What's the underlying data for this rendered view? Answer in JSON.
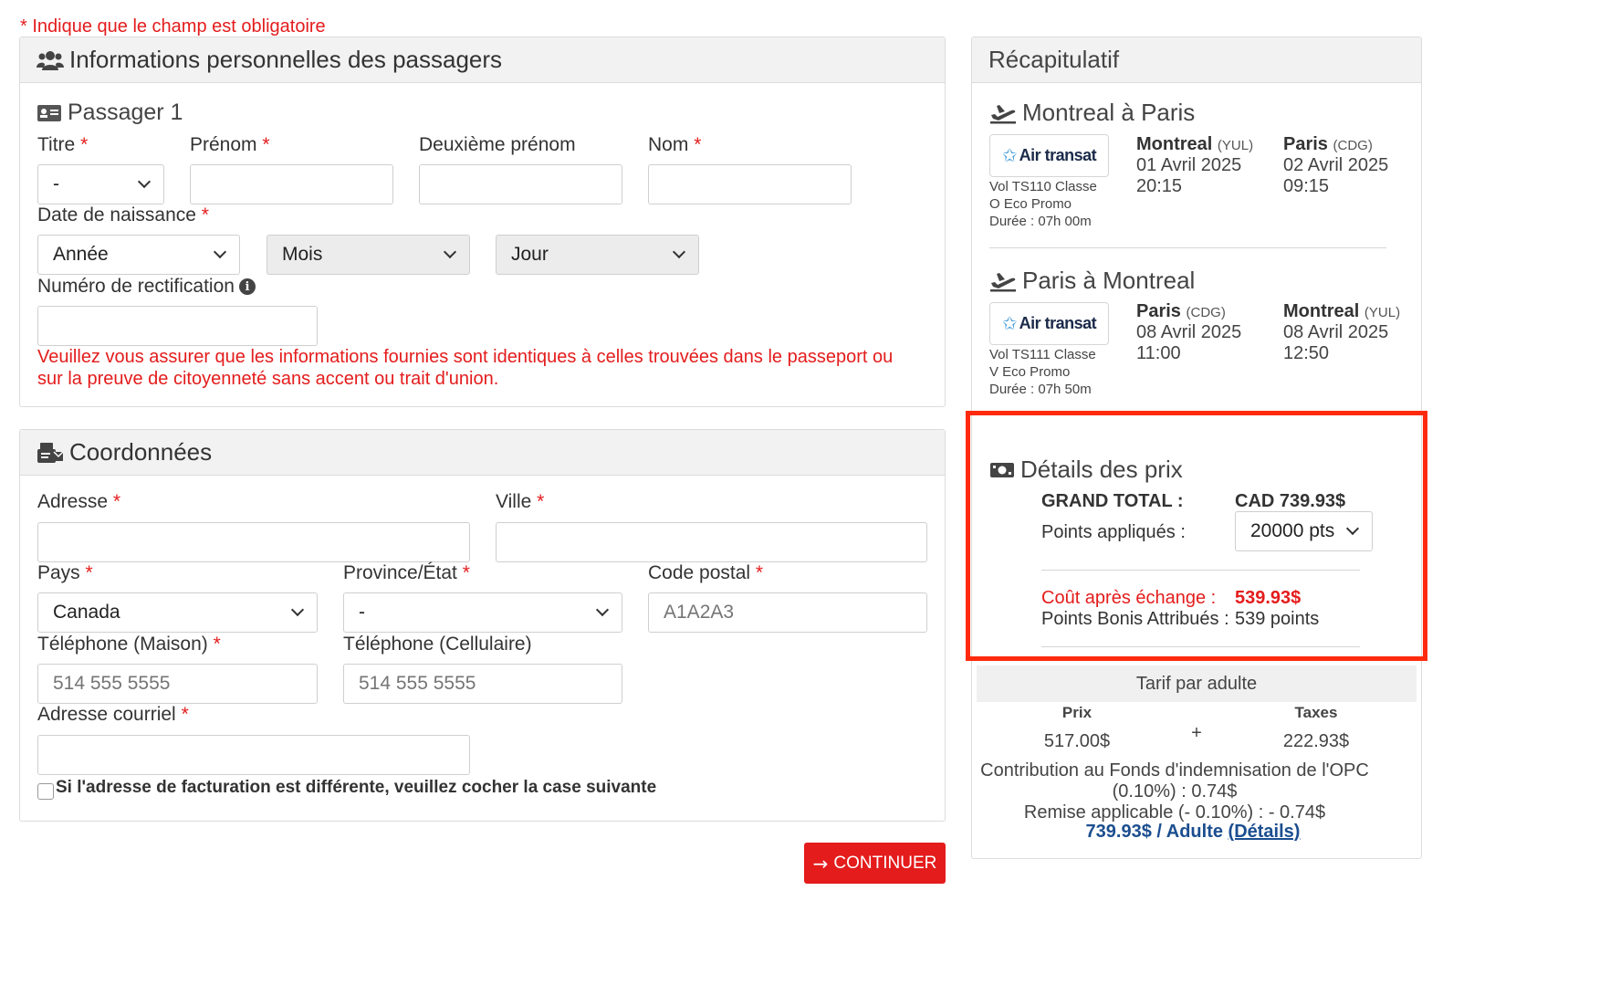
{
  "required_note": "* Indique que le champ est obligatoire",
  "passengers": {
    "title": "Informations personnelles des passagers",
    "passenger_title": "Passager 1",
    "labels": {
      "titre": "Titre",
      "prenom": "Prénom",
      "deuxieme_prenom": "Deuxième prénom",
      "nom": "Nom",
      "date_naissance": "Date de naissance",
      "numero_rectification": "Numéro de rectification"
    },
    "required_mark": "*",
    "titre_value": "-",
    "annee": "Année",
    "mois": "Mois",
    "jour": "Jour",
    "warning": "Veuillez vous assurer que les informations fournies sont identiques à celles trouvées dans le passeport ou sur la preuve de citoyenneté sans accent ou trait d'union."
  },
  "contact": {
    "title": "Coordonnées",
    "labels": {
      "adresse": "Adresse",
      "ville": "Ville",
      "pays": "Pays",
      "province": "Province/État",
      "code_postal": "Code postal",
      "tel_maison": "Téléphone (Maison)",
      "tel_cell": "Téléphone (Cellulaire)",
      "courriel": "Adresse courriel"
    },
    "pays_value": "Canada",
    "province_value": "-",
    "code_postal_placeholder": "A1A2A3",
    "tel_maison_placeholder": "514 555 5555",
    "tel_cell_placeholder": "514 555 5555",
    "billing_checkbox_label": "Si l'adresse de facturation est différente, veuillez cocher la case suivante"
  },
  "continue_button": "CONTINUER",
  "summary": {
    "title": "Récapitulatif",
    "airline_logo": "Air transat",
    "flights": [
      {
        "route": "Montreal à Paris",
        "flight_info": [
          "Vol TS110 Classe",
          "O Eco Promo",
          "Durée : 07h 00m"
        ],
        "dep_city": "Montreal",
        "dep_code": "(YUL)",
        "dep_date": "01 Avril 2025",
        "dep_time": "20:15",
        "arr_city": "Paris",
        "arr_code": "(CDG)",
        "arr_date": "02 Avril 2025",
        "arr_time": "09:15"
      },
      {
        "route": "Paris à Montreal",
        "flight_info": [
          "Vol TS111 Classe",
          "V Eco Promo",
          "Durée : 07h 50m"
        ],
        "dep_city": "Paris",
        "dep_code": "(CDG)",
        "dep_date": "08 Avril 2025",
        "dep_time": "11:00",
        "arr_city": "Montreal",
        "arr_code": "(YUL)",
        "arr_date": "08 Avril 2025",
        "arr_time": "12:50"
      }
    ],
    "price_details": {
      "title": "Détails des prix",
      "grand_total_label": "GRAND TOTAL :",
      "grand_total_value": "CAD 739.93$",
      "points_label": "Points appliqués :",
      "points_value": "20000 pts",
      "cost_label": "Coût après échange :",
      "cost_value": "539.93$",
      "bonus_label": "Points Bonis Attribués :",
      "bonus_value": "539 points"
    },
    "tarif": {
      "title": "Tarif par adulte",
      "prix_label": "Prix",
      "taxes_label": "Taxes",
      "prix_value": "517.00$",
      "plus": "+",
      "taxes_value": "222.93$",
      "contribution_line1": "Contribution au Fonds d'indemnisation de l'OPC",
      "contribution_line2": "(0.10%) : 0.74$",
      "remise": "Remise applicable (- 0.10%) : - 0.74$",
      "total": "739.93$ / Adulte",
      "details_link": "(Détails)"
    }
  }
}
